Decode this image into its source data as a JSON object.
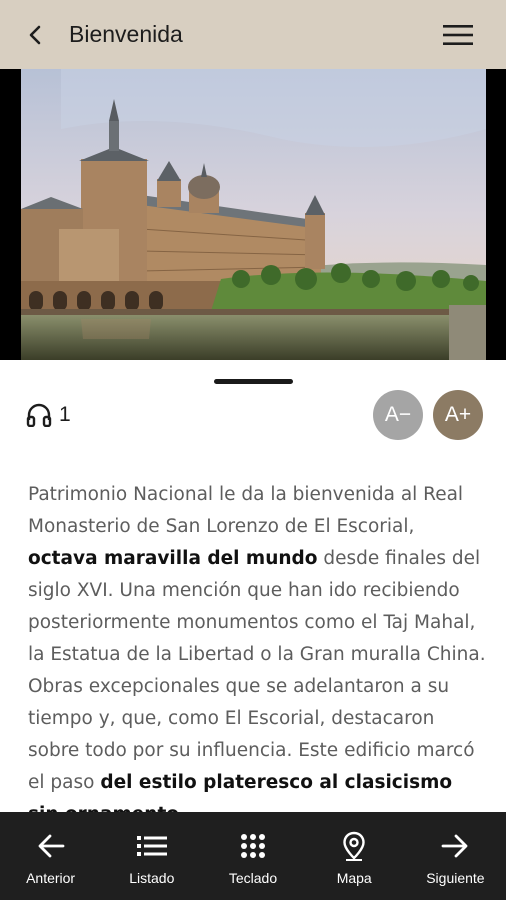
{
  "header": {
    "title": "Bienvenida",
    "back_icon": "chevron-left-icon",
    "menu_icon": "hamburger-menu-icon",
    "background_color": "#d8cfc1"
  },
  "hero": {
    "image_subject": "Real Monasterio de San Lorenzo de El Escorial with pond and gardens"
  },
  "audio": {
    "icon": "headphones-icon",
    "track_number": "1"
  },
  "font_controls": {
    "decrease_label": "A−",
    "increase_label": "A+",
    "decrease_color": "#a5a5a5",
    "increase_color": "#8c7b64"
  },
  "article": {
    "segments": [
      {
        "text": "Patrimonio Nacional le da la bienvenida al Real Monasterio de San Lorenzo de El Escorial, ",
        "bold": false
      },
      {
        "text": "octava maravilla del mundo",
        "bold": true
      },
      {
        "text": " desde finales del siglo XVI. Una mención que han  ido recibiendo posteriormente monumentos como el Taj Mahal, la Estatua de la Libertad o la Gran muralla China. Obras excepcionales que se adelantaron a su tiempo y, que, como El Escorial, destacaron sobre todo por su influencia. Este edificio marcó el paso ",
        "bold": false
      },
      {
        "text": "del estilo plateresco al clasicismo sin ornamento",
        "bold": true
      }
    ]
  },
  "bottom_nav": {
    "background_color": "#1f1f1f",
    "items": [
      {
        "label": "Anterior",
        "icon": "arrow-left-icon"
      },
      {
        "label": "Listado",
        "icon": "list-icon"
      },
      {
        "label": "Teclado",
        "icon": "keypad-icon"
      },
      {
        "label": "Mapa",
        "icon": "map-pin-icon"
      },
      {
        "label": "Siguiente",
        "icon": "arrow-right-icon"
      }
    ]
  }
}
